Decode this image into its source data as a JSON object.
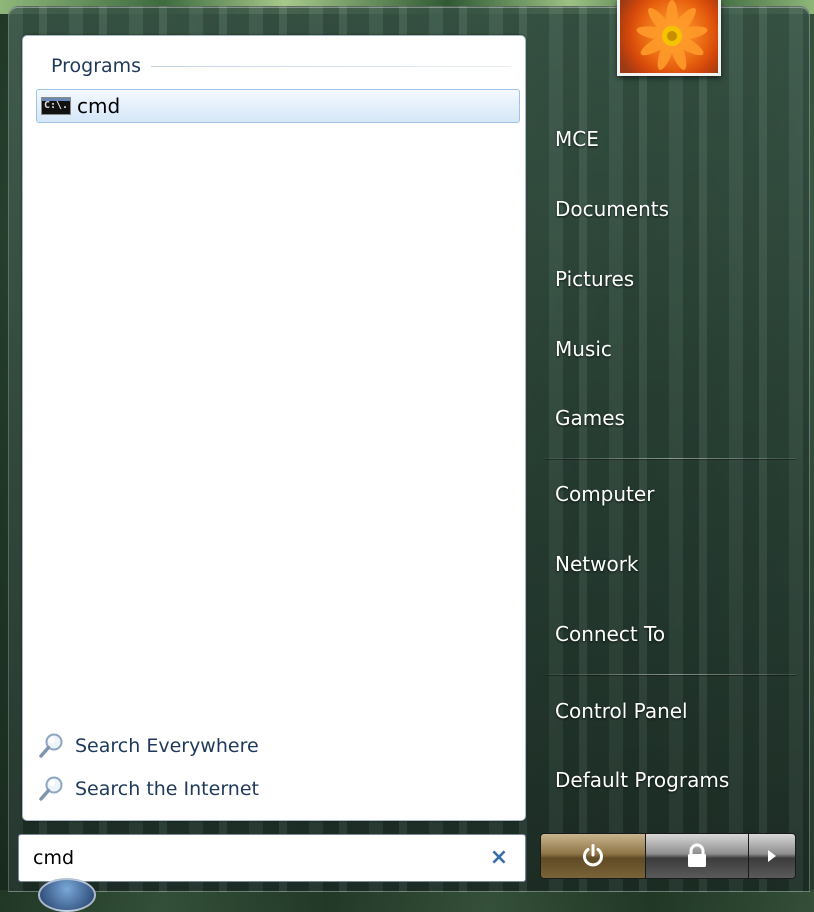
{
  "left_pane": {
    "section_title": "Programs",
    "results": [
      {
        "label": "cmd",
        "icon": "command-prompt-icon",
        "icon_text": "C:\\."
      }
    ],
    "search_links": [
      {
        "label": "Search Everywhere",
        "icon": "search-icon"
      },
      {
        "label": "Search the Internet",
        "icon": "search-icon"
      }
    ]
  },
  "search": {
    "value": "cmd",
    "clear_label": "×"
  },
  "right_pane": {
    "items": [
      {
        "label": "MCE"
      },
      {
        "label": "Documents"
      },
      {
        "label": "Pictures"
      },
      {
        "label": "Music"
      },
      {
        "label": "Games"
      },
      {
        "label": "Computer"
      },
      {
        "label": "Network"
      },
      {
        "label": "Connect To"
      },
      {
        "label": "Control Panel"
      },
      {
        "label": "Default Programs"
      }
    ]
  },
  "power_bar": {
    "buttons": [
      {
        "icon": "power-icon"
      },
      {
        "icon": "lock-icon"
      },
      {
        "icon": "arrow-right-icon"
      }
    ]
  },
  "colors": {
    "link_text": "#1e395b",
    "selection_border": "#9fc4e8",
    "power_button": "#8f7647"
  }
}
